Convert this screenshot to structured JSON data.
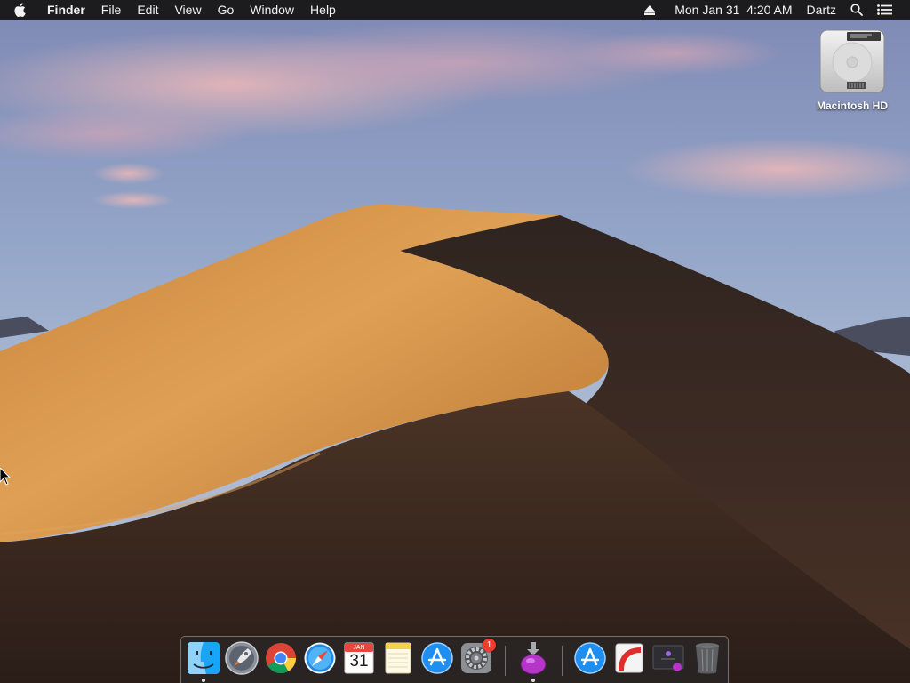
{
  "menubar": {
    "apple_icon": "apple-logo-icon",
    "items": [
      "Finder",
      "File",
      "Edit",
      "View",
      "Go",
      "Window",
      "Help"
    ],
    "status": {
      "eject_icon": "eject-icon",
      "clock": "Mon Jan 31  4:20 AM",
      "user": "Dartz",
      "search_icon": "spotlight-search-icon",
      "notification_icon": "notification-center-icon"
    }
  },
  "desktop": {
    "drive_label": "Macintosh HD",
    "drive_icon": "hard-drive-icon"
  },
  "dock": {
    "calendar": {
      "month": "JAN",
      "day": "31"
    },
    "system_preferences_badge": "1",
    "icons": [
      "finder-icon",
      "launchpad-icon",
      "chrome-icon",
      "safari-icon",
      "calendar-icon",
      "notes-icon",
      "app-store-icon",
      "system-preferences-icon",
      "installer-icon",
      "app-store-icon",
      "app-icon",
      "app-icon",
      "trash-icon"
    ]
  },
  "colors": {
    "menubar_bg": "#1c1c1e",
    "sky_top": "#8e9bc0",
    "dune_light": "#d9984a",
    "dune_shadow": "#3a2a22",
    "badge": "#f13b2f"
  }
}
